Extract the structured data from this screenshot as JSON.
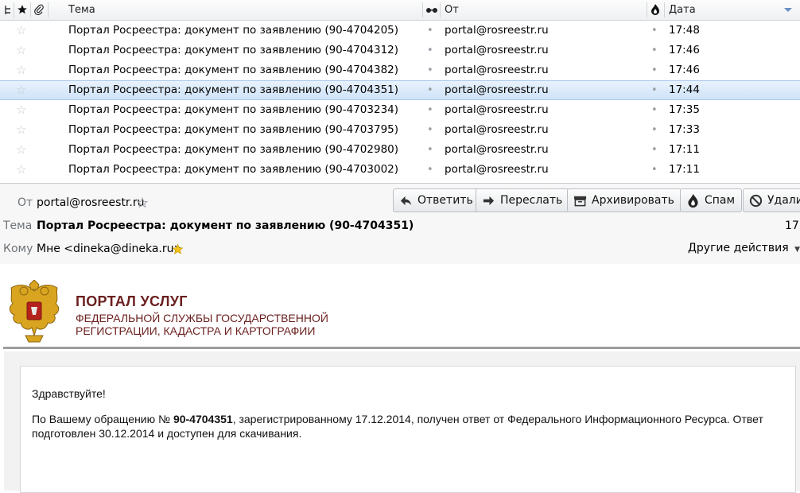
{
  "list": {
    "columns": {
      "subject": "Тема",
      "from": "От",
      "date": "Дата"
    },
    "rows": [
      {
        "subject": "Портал Росреестра: документ по заявлению (90-4704205)",
        "from": "portal@rosreestr.ru",
        "date": "17:48"
      },
      {
        "subject": "Портал Росреестра: документ по заявлению (90-4704312)",
        "from": "portal@rosreestr.ru",
        "date": "17:46"
      },
      {
        "subject": "Портал Росреестра: документ по заявлению (90-4704382)",
        "from": "portal@rosreestr.ru",
        "date": "17:46"
      },
      {
        "subject": "Портал Росреестра: документ по заявлению (90-4704351)",
        "from": "portal@rosreestr.ru",
        "date": "17:44"
      },
      {
        "subject": "Портал Росреестра: документ по заявлению (90-4703234)",
        "from": "portal@rosreestr.ru",
        "date": "17:35"
      },
      {
        "subject": "Портал Росреестра: документ по заявлению (90-4703795)",
        "from": "portal@rosreestr.ru",
        "date": "17:33"
      },
      {
        "subject": "Портал Росреестра: документ по заявлению (90-4702980)",
        "from": "portal@rosreestr.ru",
        "date": "17:11"
      },
      {
        "subject": "Портал Росреестра: документ по заявлению (90-4703002)",
        "from": "portal@rosreestr.ru",
        "date": "17:11"
      }
    ],
    "selected_index": 3,
    "icons": {
      "thread": "thread-icon",
      "star": "star-icon",
      "attachment": "paperclip-icon",
      "read": "glasses-icon",
      "junk": "flame-icon"
    }
  },
  "message": {
    "from_label": "От",
    "from_value": "portal@rosreestr.ru",
    "subject_label": "Тема",
    "subject_value": "Портал Росреестра: документ по заявлению (90-4704351)",
    "time_value": "17:",
    "to_label": "Кому",
    "to_value": "Мне <dineka@dineka.ru>",
    "more_actions": "Другие действия",
    "buttons": {
      "reply": "Ответить",
      "forward": "Переслать",
      "archive": "Архивировать",
      "junk": "Спам",
      "delete": "Удали"
    }
  },
  "body": {
    "banner_title": "ПОРТАЛ УСЛУГ",
    "banner_line1": "ФЕДЕРАЛЬНОЙ СЛУЖБЫ ГОСУДАРСТВЕННОЙ",
    "banner_line2": "РЕГИСТРАЦИИ, КАДАСТРА И КАРТОГРАФИИ",
    "greeting": "Здравствуйте!",
    "para_prefix": "По Вашему обращению № ",
    "para_number": "90-4704351",
    "para_suffix": ", зарегистрированному 17.12.2014, получен ответ от Федерального Информационного Ресурса. Ответ",
    "para_line2": "подготовлен 30.12.2014 и доступен для скачивания."
  },
  "colors": {
    "accent": "#6b8fc6",
    "banner": "#6b1f1f",
    "selection": "#cfe3f8",
    "star_inactive": "#c8ccd2",
    "star_active": "#f3c21b"
  }
}
